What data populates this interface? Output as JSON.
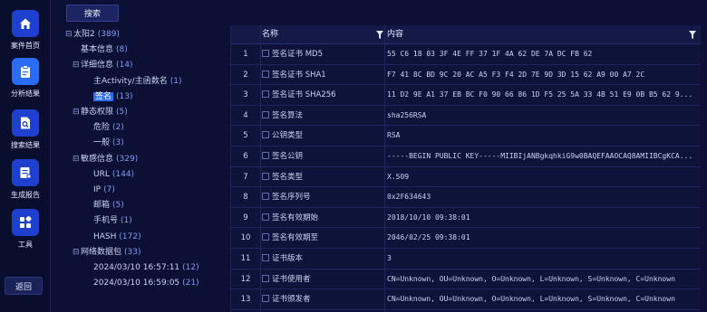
{
  "nav": {
    "items": [
      {
        "label": "案件首页",
        "icon": "home-icon"
      },
      {
        "label": "分析结果",
        "icon": "clipboard-icon"
      },
      {
        "label": "搜索结果",
        "icon": "document-search-icon"
      },
      {
        "label": "生成报告",
        "icon": "report-icon"
      },
      {
        "label": "工具",
        "icon": "apps-icon"
      }
    ],
    "back_label": "返回"
  },
  "toolbar": {
    "search_label": "搜索"
  },
  "tree": [
    {
      "label": "太阳2",
      "count": "(389)",
      "toggle": "⊟",
      "level": 0
    },
    {
      "label": "基本信息",
      "count": "(8)",
      "toggle": "",
      "level": 1
    },
    {
      "label": "详细信息",
      "count": "(14)",
      "toggle": "⊟",
      "level": 1
    },
    {
      "label": "主Activity/主函数名",
      "count": "(1)",
      "toggle": "",
      "level": 2
    },
    {
      "label": "签名",
      "count": "(13)",
      "toggle": "",
      "level": 2,
      "selected": true
    },
    {
      "label": "静态权限",
      "count": "(5)",
      "toggle": "⊟",
      "level": 1
    },
    {
      "label": "危险",
      "count": "(2)",
      "toggle": "",
      "level": 2
    },
    {
      "label": "一般",
      "count": "(3)",
      "toggle": "",
      "level": 2
    },
    {
      "label": "敏感信息",
      "count": "(329)",
      "toggle": "⊟",
      "level": 1
    },
    {
      "label": "URL",
      "count": "(144)",
      "toggle": "",
      "level": 2
    },
    {
      "label": "IP",
      "count": "(7)",
      "toggle": "",
      "level": 2
    },
    {
      "label": "邮箱",
      "count": "(5)",
      "toggle": "",
      "level": 2
    },
    {
      "label": "手机号",
      "count": "(1)",
      "toggle": "",
      "level": 2
    },
    {
      "label": "HASH",
      "count": "(172)",
      "toggle": "",
      "level": 2
    },
    {
      "label": "网络数据包",
      "count": "(33)",
      "toggle": "⊟",
      "level": 1
    },
    {
      "label": "2024/03/10 16:57:11",
      "count": "(12)",
      "toggle": "",
      "level": 2
    },
    {
      "label": "2024/03/10 16:59:05",
      "count": "(21)",
      "toggle": "",
      "level": 2
    }
  ],
  "table": {
    "columns": [
      "名称",
      "内容"
    ],
    "rows": [
      {
        "idx": "1",
        "name": "签名证书 MD5",
        "value": "55 C6 18 03 3F 4E FF 37 1F 4A 62 DE 7A DC FB 62"
      },
      {
        "idx": "2",
        "name": "签名证书 SHA1",
        "value": "F7 41 8C BD 9C 20 AC A5 F3 F4 2D 7E 9D 3D 15 62 A9 00 A7 2C"
      },
      {
        "idx": "3",
        "name": "签名证书 SHA256",
        "value": "11 D2 9E A1 37 EB BC F0 90 66 86 1D F5 25 5A 33 4B 51 E9 0B B5 62 9..."
      },
      {
        "idx": "4",
        "name": "签名算法",
        "value": "sha256RSA"
      },
      {
        "idx": "5",
        "name": "公钥类型",
        "value": "RSA"
      },
      {
        "idx": "6",
        "name": "签名公钥",
        "value": "-----BEGIN PUBLIC KEY-----MIIBIjANBgkqhkiG9w0BAQEFAAOCAQ8AMIIBCgKCA..."
      },
      {
        "idx": "7",
        "name": "签名类型",
        "value": "X.509"
      },
      {
        "idx": "8",
        "name": "签名序列号",
        "value": "0x2F634643"
      },
      {
        "idx": "9",
        "name": "签名有效期始",
        "value": "2018/10/10 09:38:01"
      },
      {
        "idx": "10",
        "name": "签名有效期至",
        "value": "2046/02/25 09:38:01"
      },
      {
        "idx": "11",
        "name": "证书版本",
        "value": "3"
      },
      {
        "idx": "12",
        "name": "证书使用者",
        "value": "CN=Unknown, OU=Unknown, O=Unknown, L=Unknown, S=Unknown, C=Unknown"
      },
      {
        "idx": "13",
        "name": "证书颁发者",
        "value": "CN=Unknown, OU=Unknown, O=Unknown, L=Unknown, S=Unknown, C=Unknown"
      }
    ]
  },
  "colors": {
    "accent": "#2d6bf0",
    "background": "#0b1034",
    "panel": "#0d1339"
  }
}
